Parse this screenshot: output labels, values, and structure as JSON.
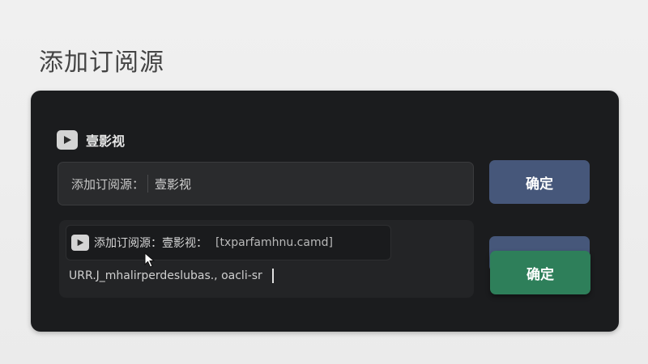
{
  "page": {
    "title": "添加订阅源"
  },
  "source": {
    "name": "壹影视",
    "icon": "play-icon"
  },
  "row1": {
    "label": "添加订阅源：",
    "value": "壹影视",
    "button_label": "确定"
  },
  "row2": {
    "field_text": "添加订阅源：壹影视：",
    "field_url": "[txparfamhnu.camd]",
    "input_text": "URR.J_mhalirperdeslubas., oacli-sr",
    "button_back_label": "",
    "button_label": "确定"
  },
  "colors": {
    "panel_bg": "#1b1c1e",
    "button_blue": "#46577a",
    "button_green": "#2e7f5a"
  }
}
